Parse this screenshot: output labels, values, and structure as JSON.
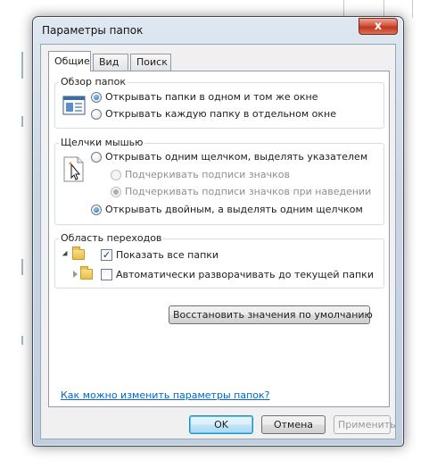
{
  "window": {
    "title": "Параметры папок",
    "close": "x"
  },
  "tabs": [
    {
      "label": "Общие"
    },
    {
      "label": "Вид"
    },
    {
      "label": "Поиск"
    }
  ],
  "browse_group": {
    "label": "Обзор папок",
    "options": [
      {
        "label": "Открывать папки в одном и том же окне",
        "selected": true
      },
      {
        "label": "Открывать каждую папку в отдельном окне",
        "selected": false
      }
    ]
  },
  "click_group": {
    "label": "Щелчки мышью",
    "options": [
      {
        "label": "Открывать одним щелчком, выделять указателем",
        "selected": false
      },
      {
        "label": "Подчеркивать подписи значков",
        "selected": false,
        "disabled": true
      },
      {
        "label": "Подчеркивать подписи значков при наведении",
        "selected": true,
        "disabled": true
      },
      {
        "label": "Открывать двойным, а выделять одним щелчком",
        "selected": true
      }
    ]
  },
  "nav_group": {
    "label": "Область переходов",
    "options": [
      {
        "label": "Показать все папки",
        "checked": true
      },
      {
        "label": "Автоматически разворачивать до текущей папки",
        "checked": false
      }
    ]
  },
  "restore_button": "Восстановить значения по умолчанию",
  "help_link": "Как можно изменить параметры папок?",
  "footer": {
    "ok": "OK",
    "cancel": "Отмена",
    "apply": "Применить"
  }
}
